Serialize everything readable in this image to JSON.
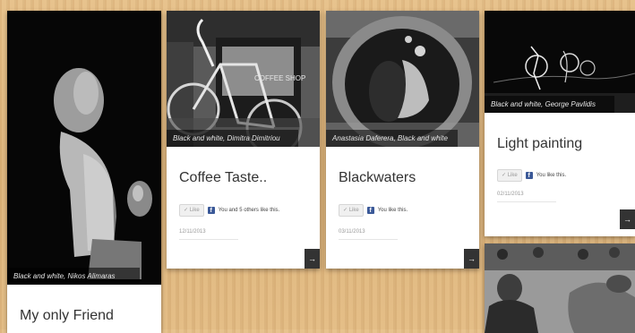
{
  "cards": [
    {
      "caption": "Black and white, Nikos Alimaras",
      "title": "My only Friend"
    },
    {
      "caption": "Black and white, Dimitra Dimitriou",
      "title": "Coffee Taste..",
      "like_label": "Like",
      "like_text": "You and 5 others like this.",
      "date": "12/11/2013"
    },
    {
      "caption": "Anastasia Daferera, Black and white",
      "title": "Blackwaters",
      "like_label": "Like",
      "like_text": "You like this.",
      "date": "03/11/2013"
    },
    {
      "caption": "Black and white, George Pavlidis",
      "title": "Light painting",
      "like_label": "Like",
      "like_text": "You like this.",
      "date": "02/11/2013"
    }
  ],
  "colors": {
    "arrow_button": "#333333",
    "facebook": "#3b5998"
  }
}
